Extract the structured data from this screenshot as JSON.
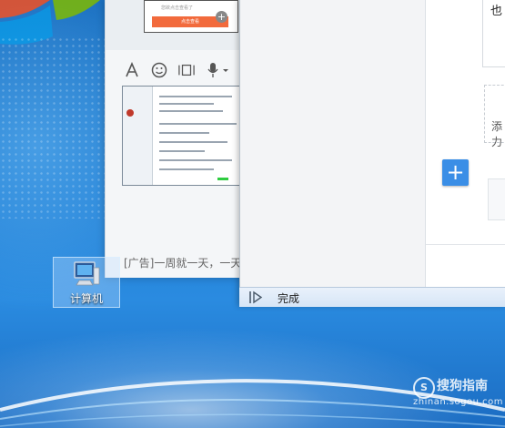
{
  "desktop": {
    "icon_label": "计算机",
    "watermark_name": "搜狗指南",
    "watermark_url": "zhinan.sogou.com",
    "watermark_logo": "S"
  },
  "chat_window": {
    "ad_card_text": "您欲点击查看了",
    "ad_card_button": "点击查看",
    "ad_text": "[广告]一周就一天，一天",
    "toolbar": [
      "font-icon",
      "emoji-icon",
      "screenshot-icon",
      "microphone-icon"
    ]
  },
  "main_window": {
    "top_char": "也",
    "add_label": "添力",
    "plus_label": "+",
    "status_done": "完成"
  },
  "colors": {
    "accent": "#3a8ee6",
    "ad_button": "#f26a3c"
  }
}
